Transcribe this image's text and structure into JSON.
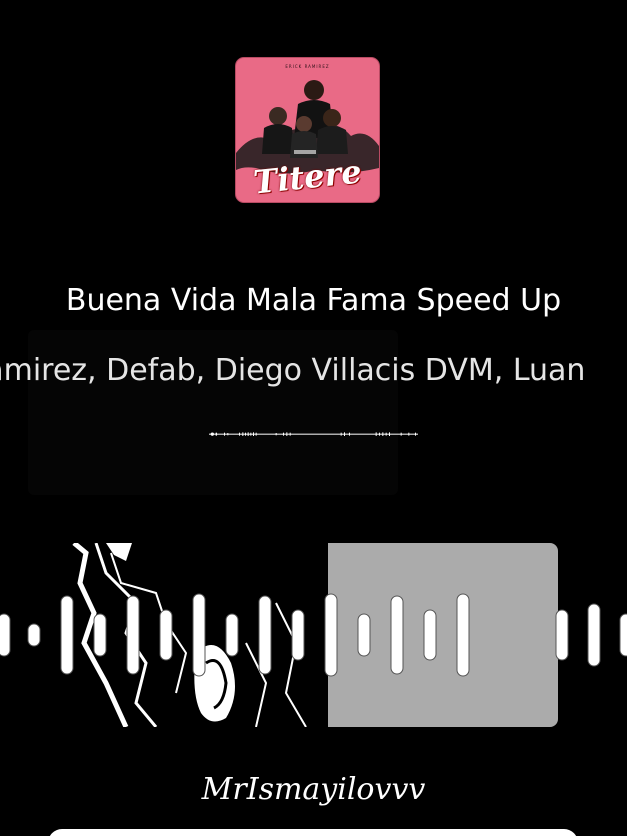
{
  "album": {
    "cover_title": "Titere",
    "cover_artist": "ERICK RAMIREZ"
  },
  "track": {
    "title": "Buena Vida Mala Fama Speed Up",
    "artists": "Erick Ramirez, Defab, Diego Villacis DVM, Luan"
  },
  "footer": {
    "signature": "MrIsmayilovvv"
  },
  "colors": {
    "background": "#000000",
    "cover_pink": "#e96a86",
    "visualizer": "#ffffff",
    "preview_gray": "#ababab"
  },
  "icons": {
    "album_art": "album-cover-image",
    "progress": "waveform-progress-bar",
    "visualizer": "audio-visualizer-bars"
  }
}
